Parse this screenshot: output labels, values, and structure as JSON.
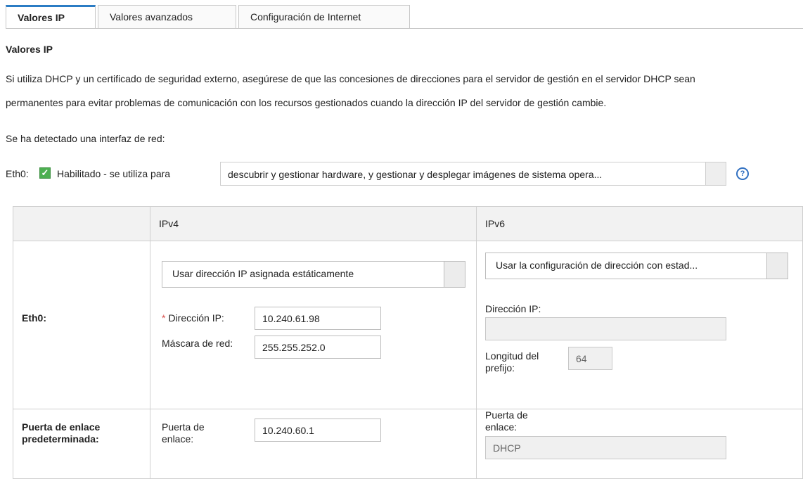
{
  "tabs": [
    {
      "label": "Valores IP",
      "active": true
    },
    {
      "label": "Valores avanzados",
      "active": false
    },
    {
      "label": "Configuración de Internet",
      "active": false
    }
  ],
  "section_title": "Valores IP",
  "intro": {
    "line1": "Si utiliza DHCP y un certificado de seguridad externo, asegúrese de que las concesiones de direcciones para el servidor de gestión en el servidor DHCP sean",
    "line2": "permanentes para evitar problemas de comunicación con los recursos gestionados cuando la dirección IP del servidor de gestión cambie.",
    "detected": "Se ha detectado una interfaz de red:"
  },
  "interface": {
    "name": "Eth0:",
    "enabled_checked": true,
    "enabled_label": "Habilitado - se utiliza para",
    "usage_value": "descubrir y gestionar hardware, y gestionar y desplegar imágenes de sistema opera...",
    "help_icon": "help-icon"
  },
  "table": {
    "headers": {
      "col0": "",
      "ipv4": "IPv4",
      "ipv6": "IPv6"
    },
    "eth0_row": {
      "label": "Eth0:",
      "ipv4": {
        "mode": "Usar dirección IP asignada estáticamente",
        "required_mark": "*",
        "ip_label": "Dirección IP:",
        "ip_value": "10.240.61.98",
        "mask_label": "Máscara de red:",
        "mask_value": "255.255.252.0"
      },
      "ipv6": {
        "mode": "Usar la configuración de dirección con estad...",
        "ip_label": "Dirección IP:",
        "ip_value": "",
        "prefix_label": "Longitud del prefijo:",
        "prefix_value": "64"
      }
    },
    "gateway_row": {
      "label": "Puerta de enlace predeterminada:",
      "ipv4": {
        "label": "Puerta de enlace:",
        "value": "10.240.60.1"
      },
      "ipv6": {
        "label": "Puerta de enlace:",
        "value": "DHCP"
      }
    }
  },
  "colors": {
    "accent": "#2b7cc4",
    "checkbox": "#4caf50",
    "required": "#d9534f",
    "help": "#2f6fc1"
  }
}
